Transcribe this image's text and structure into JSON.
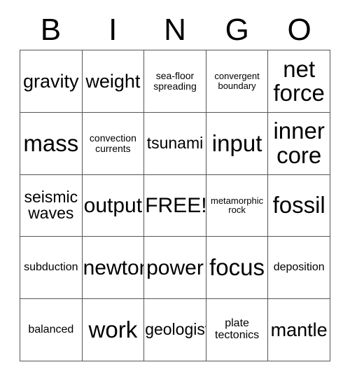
{
  "card": {
    "header_letters": [
      "B",
      "I",
      "N",
      "G",
      "O"
    ],
    "rows": [
      [
        {
          "text": "gravity",
          "size": "t-lg"
        },
        {
          "text": "weight",
          "size": "t-lg"
        },
        {
          "text": "sea-floor spreading",
          "size": "t-xs"
        },
        {
          "text": "convergent boundary",
          "size": "t-xxs"
        },
        {
          "text": "net force",
          "size": "t-xxl"
        }
      ],
      [
        {
          "text": "mass",
          "size": "t-xxl"
        },
        {
          "text": "convection currents",
          "size": "t-xs"
        },
        {
          "text": "tsunami",
          "size": "t-md"
        },
        {
          "text": "input",
          "size": "t-xxl"
        },
        {
          "text": "inner core",
          "size": "t-xxl"
        }
      ],
      [
        {
          "text": "seismic waves",
          "size": "t-md"
        },
        {
          "text": "output",
          "size": "t-xl"
        },
        {
          "text": "FREE!",
          "size": "t-xl"
        },
        {
          "text": "metamorphic rock",
          "size": "t-xxs"
        },
        {
          "text": "fossil",
          "size": "t-xxl"
        }
      ],
      [
        {
          "text": "subduction",
          "size": "t-sm"
        },
        {
          "text": "newton",
          "size": "t-xl"
        },
        {
          "text": "power",
          "size": "t-xl"
        },
        {
          "text": "focus",
          "size": "t-xxl"
        },
        {
          "text": "deposition",
          "size": "t-sm"
        }
      ],
      [
        {
          "text": "balanced",
          "size": "t-sm"
        },
        {
          "text": "work",
          "size": "t-xxl"
        },
        {
          "text": "geologist",
          "size": "t-md"
        },
        {
          "text": "plate tectonics",
          "size": "t-sm"
        },
        {
          "text": "mantle",
          "size": "t-lg"
        }
      ]
    ]
  },
  "colors": {
    "background": "#ffffff",
    "text": "#000000",
    "border": "#555555"
  }
}
